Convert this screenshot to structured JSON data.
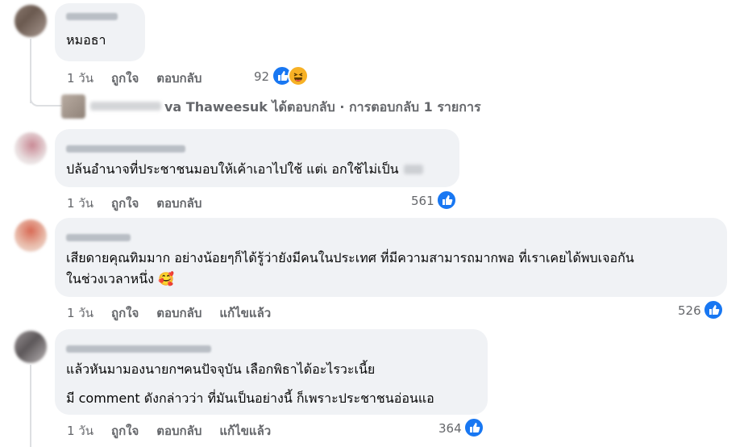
{
  "comments": [
    {
      "text_lines": [
        "หมอธา"
      ],
      "actions": [
        "1 วัน",
        "ถูกใจ",
        "ตอบกลับ"
      ],
      "reaction_count": "92",
      "reactions": [
        "like-icon",
        "haha-icon"
      ]
    },
    {
      "text_lines": [
        "ปล้นอำนาจที่ประชาชนมอบให้เค้าเอาไปใช้ แต่เ  อกใช้ไม่เป็น"
      ],
      "actions": [
        "1 วัน",
        "ถูกใจ",
        "ตอบกลับ"
      ],
      "reaction_count": "561",
      "reactions": [
        "like-icon"
      ]
    },
    {
      "text_lines": [
        "เสียดายคุณทิมมาก อย่างน้อยๆก็ได้รู้ว่ายังมีคนในประเทศ ที่มีความสามารถมากพอ ที่เราเคยได้พบเจอกัน",
        "ในช่วงเวลาหนึ่ง 🥰"
      ],
      "actions": [
        "1 วัน",
        "ถูกใจ",
        "ตอบกลับ",
        "แก้ไขแล้ว"
      ],
      "reaction_count": "526",
      "reactions": [
        "like-icon"
      ]
    },
    {
      "text_lines": [
        "แล้วหันมามองนายกฯคนปัจจุบัน เลือกพิธาได้อะไรวะเนี้ย",
        "มี comment ดังกล่าวว่า ที่มันเป็นอย่างนี้ ก็เพราะประชาชนอ่อนแอ"
      ],
      "actions": [
        "1 วัน",
        "ถูกใจ",
        "ตอบกลับ",
        "แก้ไขแล้ว"
      ],
      "reaction_count": "364",
      "reactions": [
        "like-icon"
      ]
    }
  ],
  "reply_summary": {
    "text": "va Thaweesuk ได้ตอบกลับ · การตอบกลับ 1 รายการ"
  },
  "colors": {
    "bubble": "#f0f2f5",
    "meta": "#65676b",
    "like": "#1877f2",
    "haha": "#f7b125"
  }
}
